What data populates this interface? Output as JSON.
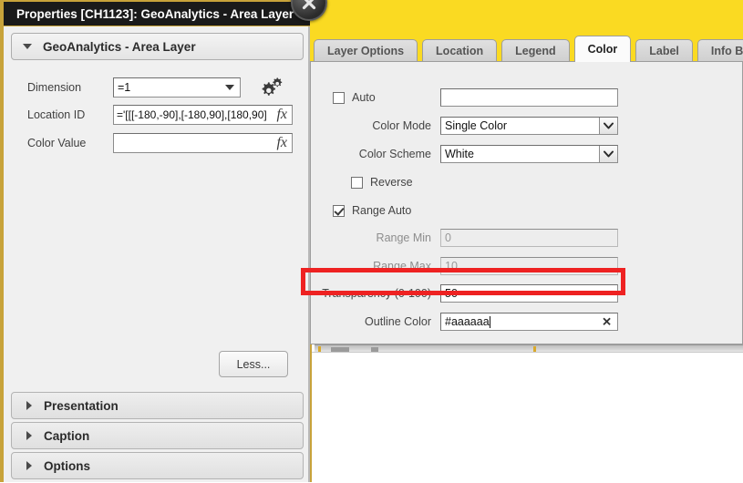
{
  "dialog": {
    "title": "Properties [CH1123]: GeoAnalytics - Area Layer",
    "close_icon": "close-icon",
    "section": {
      "title": "GeoAnalytics - Area Layer",
      "expand_icon": "chevron-down-icon"
    },
    "fields": [
      {
        "label": "Dimension",
        "value": "=1",
        "type": "select",
        "icon": "chevron-down-icon"
      },
      {
        "label": "Location ID",
        "value": "='[[[-180,-90],[-180,90],[180,90]",
        "type": "formula",
        "icon": "fx-icon"
      },
      {
        "label": "Color Value",
        "value": "",
        "type": "formula",
        "icon": "fx-icon"
      }
    ],
    "gear_icon": "gear-icon",
    "less_button": "Less...",
    "accordion": [
      {
        "label": "Presentation",
        "icon": "chevron-right-icon"
      },
      {
        "label": "Caption",
        "icon": "chevron-right-icon"
      },
      {
        "label": "Options",
        "icon": "chevron-right-icon"
      }
    ]
  },
  "tabs": [
    {
      "label": "Layer Options",
      "active": false
    },
    {
      "label": "Location",
      "active": false
    },
    {
      "label": "Legend",
      "active": false
    },
    {
      "label": "Color",
      "active": true
    },
    {
      "label": "Label",
      "active": false
    },
    {
      "label": "Info Bubble",
      "active": false
    }
  ],
  "color_tab": {
    "auto": {
      "label": "Auto",
      "checked": false,
      "value": ""
    },
    "color_mode": {
      "label": "Color Mode",
      "value": "Single Color",
      "icon": "chevron-down-icon"
    },
    "color_scheme": {
      "label": "Color Scheme",
      "value": "White",
      "icon": "chevron-down-icon"
    },
    "reverse": {
      "label": "Reverse",
      "checked": false
    },
    "range_auto": {
      "label": "Range Auto",
      "checked": true
    },
    "range_min": {
      "label": "Range Min",
      "value": "0",
      "readonly": true
    },
    "range_max": {
      "label": "Range Max",
      "value": "10",
      "readonly": true
    },
    "transparency": {
      "label": "Transparency (0-100)",
      "value": "50",
      "highlighted": true
    },
    "outline_color": {
      "label": "Outline Color",
      "value": "#aaaaaa",
      "clear_icon": "close-icon"
    }
  },
  "colors": {
    "banner": "#fada22",
    "highlight": "#ee2222",
    "titlebar": "#1a1a1a",
    "accent_border": "#c8a33a",
    "panel": "#eeeeee"
  }
}
